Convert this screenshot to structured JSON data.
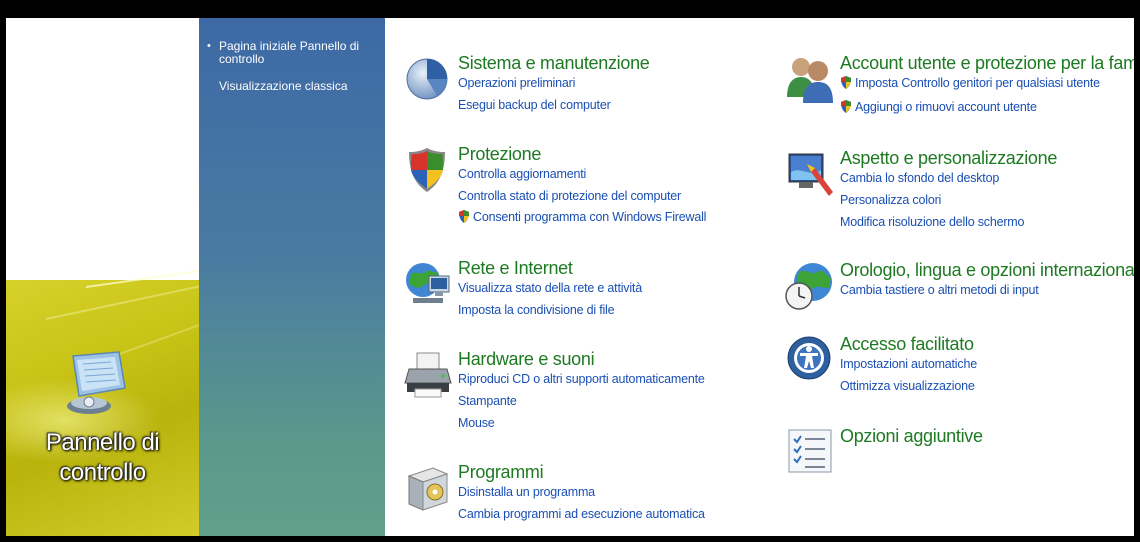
{
  "desktop": {
    "icon_label_line1": "Pannello di",
    "icon_label_line2": "controllo"
  },
  "sidebar": {
    "items": [
      {
        "label": "Pagina iniziale Pannello di controllo"
      },
      {
        "label": "Visualizzazione classica"
      }
    ]
  },
  "categories": {
    "system": {
      "title": "Sistema e manutenzione",
      "links": [
        "Operazioni preliminari",
        "Esegui backup del computer"
      ]
    },
    "security": {
      "title": "Protezione",
      "links": [
        "Controlla aggiornamenti",
        "Controlla stato di protezione del computer",
        "Consenti programma con Windows Firewall"
      ]
    },
    "network": {
      "title": "Rete e Internet",
      "links": [
        "Visualizza stato della rete e attività",
        "Imposta la condivisione di file"
      ]
    },
    "hardware": {
      "title": "Hardware e suoni",
      "links": [
        "Riproduci CD o altri supporti automaticamente",
        "Stampante",
        "Mouse"
      ]
    },
    "programs": {
      "title": "Programmi",
      "links": [
        "Disinstalla un programma",
        "Cambia programmi ad esecuzione automatica"
      ]
    },
    "accounts": {
      "title": "Account utente e protezione per la famiglia",
      "links": [
        "Imposta Controllo genitori per qualsiasi utente",
        "Aggiungi o rimuovi account utente"
      ]
    },
    "appearance": {
      "title": "Aspetto e personalizzazione",
      "links": [
        "Cambia lo sfondo del desktop",
        "Personalizza colori",
        "Modifica risoluzione dello schermo"
      ]
    },
    "clock": {
      "title": "Orologio, lingua e opzioni internazionali",
      "links": [
        "Cambia tastiere o altri metodi di input"
      ]
    },
    "access": {
      "title": "Accesso facilitato",
      "links": [
        "Impostazioni automatiche",
        "Ottimizza visualizzazione"
      ]
    },
    "extra": {
      "title": "Opzioni aggiuntive",
      "links": []
    }
  },
  "colors": {
    "title_green": "#1e7a22",
    "link_blue": "#1a4fb5",
    "sidebar_top": "#3d69a5",
    "sidebar_bottom": "#61a08a"
  }
}
